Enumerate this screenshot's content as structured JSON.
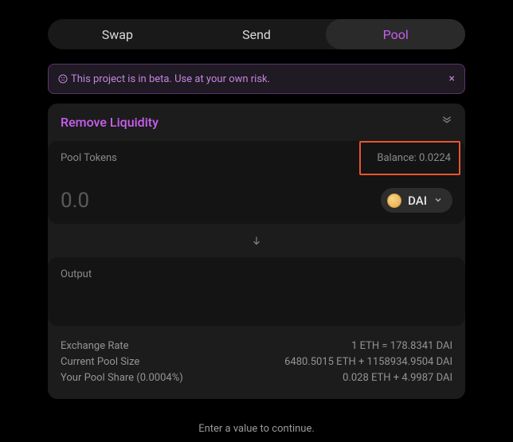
{
  "tabs": {
    "swap": "Swap",
    "send": "Send",
    "pool": "Pool"
  },
  "banner": {
    "text": "This project is in beta. Use at your own risk.",
    "close": "×"
  },
  "panel": {
    "title": "Remove Liquidity"
  },
  "poolTokens": {
    "label": "Pool Tokens",
    "balanceLabel": "Balance: 0.0224",
    "placeholder": "0.0",
    "token": "DAI"
  },
  "output": {
    "label": "Output"
  },
  "info": {
    "exchangeRate": {
      "label": "Exchange Rate",
      "value": "1 ETH = 178.8341 DAI"
    },
    "poolSize": {
      "label": "Current Pool Size",
      "value": "6480.5015 ETH + 1158934.9504 DAI"
    },
    "poolShare": {
      "label": "Your Pool Share (0.0004%)",
      "value": "0.028 ETH + 4.9987 DAI"
    }
  },
  "footer": "Enter a value to continue."
}
